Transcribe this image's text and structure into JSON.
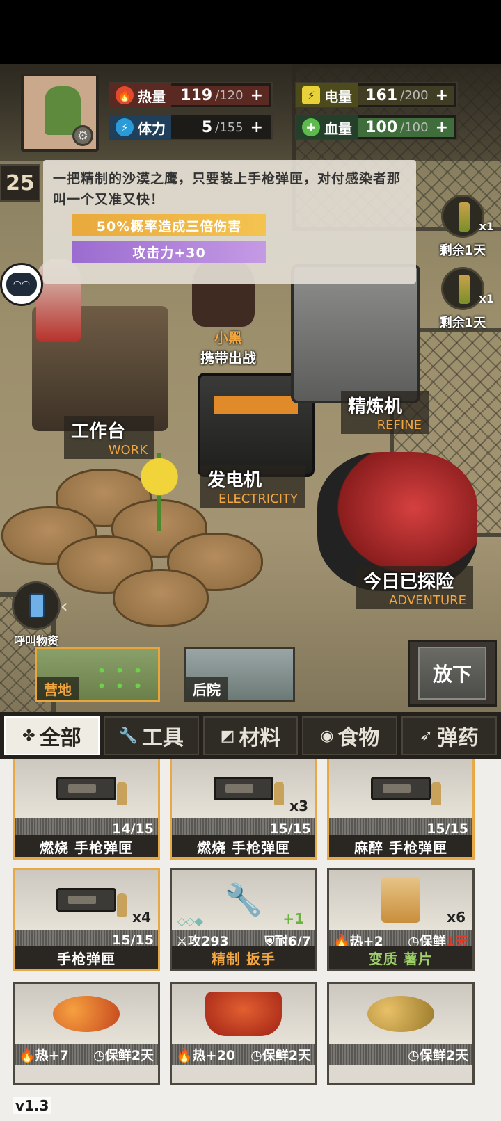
{
  "hud": {
    "heat": {
      "label": "热量",
      "value": "119",
      "max": "/120",
      "plus": "+",
      "icon": "flame-icon"
    },
    "stamina": {
      "label": "体力",
      "value": "5",
      "max": "/155",
      "plus": "+",
      "icon": "lightning-icon"
    },
    "power": {
      "label": "电量",
      "value": "161",
      "max": "/200",
      "plus": "+",
      "icon": "battery-icon"
    },
    "health": {
      "label": "血量",
      "value": "100",
      "max": "/100",
      "plus": "+",
      "icon": "blood-drop-plus-icon"
    },
    "level": "25"
  },
  "tooltip": {
    "description": "一把精制的沙漠之鹰，只要装上手枪弹匣，对付感染者那叫一个又准又快！",
    "perk1": "50%概率造成三倍伤害",
    "perk2": "攻击力+30"
  },
  "timers": [
    {
      "qty": "x1",
      "label": "剩余1天"
    },
    {
      "qty": "x1",
      "label": "剩余1天"
    }
  ],
  "scene": {
    "dog_name": "小黑",
    "dog_action": "携带出战",
    "workbench": {
      "cn": "工作台",
      "en": "WORK"
    },
    "refiner": {
      "cn": "精炼机",
      "en": "REFINE"
    },
    "generator": {
      "cn": "发电机",
      "en": "ELECTRICITY"
    },
    "adventure": {
      "cn": "今日已探险",
      "en": "ADVENTURE"
    },
    "call_supply": "呼叫物资"
  },
  "areas": {
    "camp": "营地",
    "backyard": "后院",
    "put_down": "放下"
  },
  "tabs": [
    {
      "label": "全部",
      "icon": "clover-icon"
    },
    {
      "label": "工具",
      "icon": "wrench-icon"
    },
    {
      "label": "材料",
      "icon": "material-icon"
    },
    {
      "label": "食物",
      "icon": "meat-icon"
    },
    {
      "label": "弹药",
      "icon": "bullet-icon"
    }
  ],
  "items": [
    {
      "name": "燃烧 手枪弹匣",
      "stat": "14/15"
    },
    {
      "name": "燃烧 手枪弹匣",
      "stat": "15/15",
      "count": "x3"
    },
    {
      "name": "麻醉 手枪弹匣",
      "stat": "15/15"
    },
    {
      "name": "手枪弹匣",
      "stat": "15/15",
      "count": "x4"
    },
    {
      "name": "精制 扳手",
      "attack": "攻293",
      "durability": "耐6/7",
      "bonus": "+1"
    },
    {
      "name": "变质 薯片",
      "heat": "热+2",
      "fresh": "保鲜",
      "fresh_days": "1天",
      "count": "x6"
    },
    {
      "heat": "热+7",
      "fresh": "保鲜2天"
    },
    {
      "heat": "热+20",
      "fresh": "保鲜2天"
    },
    {
      "fresh": "保鲜2天"
    }
  ],
  "version": "v1.3",
  "colors": {
    "accent": "#f2a640",
    "panel": "#24211c",
    "active_tab": "#efece4"
  }
}
